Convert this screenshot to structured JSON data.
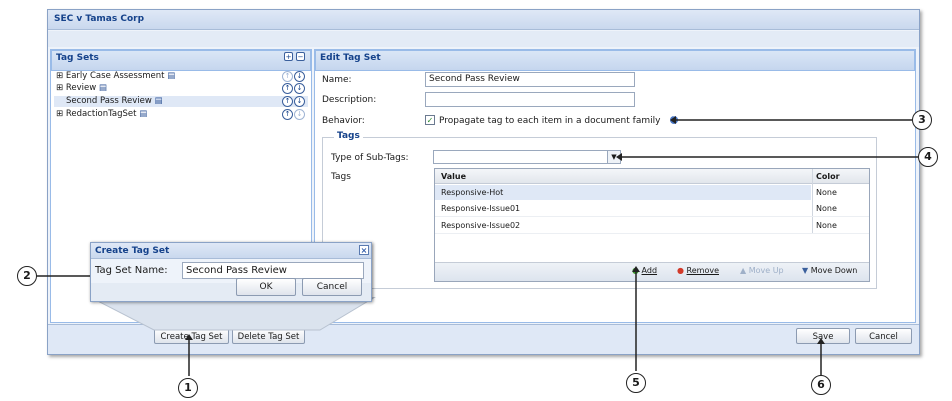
{
  "window": {
    "title": "SEC v Tamas Corp"
  },
  "tag_sets_panel": {
    "title": "Tag Sets",
    "items": [
      {
        "label": "Early Case Assessment",
        "expandable": true,
        "selected": false
      },
      {
        "label": "Review",
        "expandable": true,
        "selected": false
      },
      {
        "label": "Second Pass Review",
        "expandable": false,
        "selected": true
      },
      {
        "label": "RedactionTagSet",
        "expandable": true,
        "selected": false
      }
    ],
    "create_button": "Create Tag Set",
    "delete_button": "Delete Tag Set"
  },
  "create_dialog": {
    "title": "Create Tag Set",
    "name_label": "Tag Set Name:",
    "name_value": "Second Pass Review",
    "ok": "OK",
    "cancel": "Cancel"
  },
  "edit_panel": {
    "title": "Edit Tag Set",
    "name_label": "Name:",
    "name_value": "Second Pass Review",
    "description_label": "Description:",
    "description_value": "",
    "behavior_label": "Behavior:",
    "behavior_text": "Propagate tag to each item in a document family",
    "behavior_checked": true,
    "tags_legend": "Tags",
    "subtags_label": "Type of Sub-Tags:",
    "subtags_value": "",
    "tags_label": "Tags",
    "grid": {
      "columns": [
        "Value",
        "Color"
      ],
      "rows": [
        {
          "value": "Responsive-Hot",
          "color": "None"
        },
        {
          "value": "Responsive-Issue01",
          "color": "None"
        },
        {
          "value": "Responsive-Issue02",
          "color": "None"
        }
      ]
    },
    "grid_toolbar": {
      "add": "Add",
      "remove": "Remove",
      "move_up": "Move Up",
      "move_down": "Move Down"
    },
    "save": "Save",
    "cancel": "Cancel"
  },
  "callouts": [
    "1",
    "2",
    "3",
    "4",
    "5",
    "6"
  ],
  "colors": {
    "accent": "#15428b",
    "header_bg": "#c9d8ee",
    "selection": "#dfe8f6",
    "add_green": "#3c9a2c",
    "remove_red": "#d23a2a"
  }
}
